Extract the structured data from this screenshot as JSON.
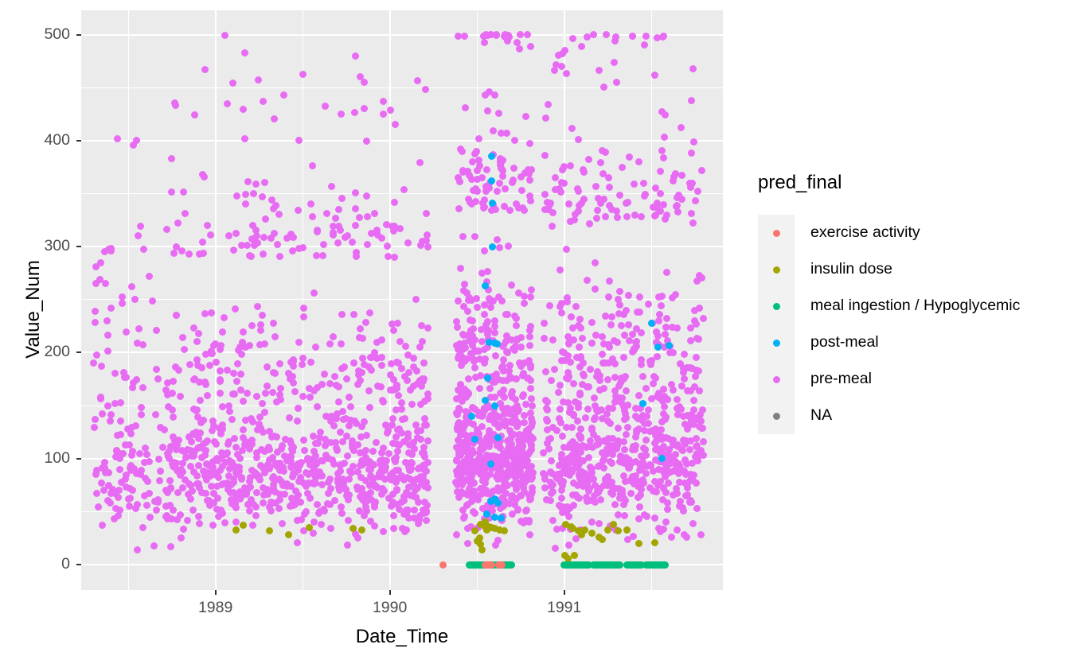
{
  "chart_data": {
    "type": "scatter",
    "title": "",
    "xlabel": "Date_Time",
    "ylabel": "Value_Num",
    "x_tick_labels": [
      "1989",
      "1990",
      "1991"
    ],
    "x_tick_values": [
      1989,
      1990,
      1991
    ],
    "y_tick_labels": [
      "0",
      "100",
      "200",
      "300",
      "400",
      "500"
    ],
    "y_tick_values": [
      0,
      100,
      200,
      300,
      400,
      500
    ],
    "xlim": [
      1988.23,
      1991.91
    ],
    "ylim": [
      -24,
      523
    ],
    "grid": true,
    "panel_background": "#EBEBEB",
    "grid_color": "#FFFFFF",
    "legend_position": "right",
    "legend_title": "pred_final",
    "series": [
      {
        "name": "exercise activity",
        "color": "#F8766D",
        "n_points": 9,
        "x_range": [
          1990.3,
          1990.72
        ],
        "y_values": [
          0,
          0,
          0,
          0,
          0,
          0,
          0,
          0,
          0
        ]
      },
      {
        "name": "insulin dose",
        "color": "#A3A500",
        "n_points": 38,
        "x_range": [
          1989.1,
          1991.62
        ],
        "y_range": [
          0,
          40
        ]
      },
      {
        "name": "meal ingestion / Hypoglycemic",
        "color": "#00BF7D",
        "n_points": 74,
        "x_range": [
          1990.45,
          1991.58
        ],
        "y_values_constant": 0
      },
      {
        "name": "post-meal",
        "color": "#00B0F6",
        "n_points": 26,
        "x_range": [
          1990.42,
          1991.62
        ],
        "y_range": [
          40,
          385
        ]
      },
      {
        "name": "pre-meal",
        "color": "#E76BF3",
        "n_points": 2600,
        "x_range": [
          1988.3,
          1991.8
        ],
        "y_range": [
          10,
          500
        ]
      },
      {
        "name": "NA",
        "color": "#808080",
        "n_points": 0,
        "x_range": [],
        "y_range": []
      }
    ]
  },
  "axes": {
    "y_title": "Value_Num",
    "x_title": "Date_Time",
    "y_ticks": [
      {
        "label": "500",
        "value": 500
      },
      {
        "label": "400",
        "value": 400
      },
      {
        "label": "300",
        "value": 300
      },
      {
        "label": "200",
        "value": 200
      },
      {
        "label": "100",
        "value": 100
      },
      {
        "label": "0",
        "value": 0
      }
    ],
    "x_ticks": [
      {
        "label": "1989",
        "value": 1989
      },
      {
        "label": "1990",
        "value": 1990
      },
      {
        "label": "1991",
        "value": 1991
      }
    ]
  },
  "legend": {
    "title": "pred_final",
    "items": [
      {
        "label": "exercise activity",
        "color": "#F8766D",
        "key_name": "legend-key-exercise-activity"
      },
      {
        "label": "insulin dose",
        "color": "#A3A500",
        "key_name": "legend-key-insulin-dose"
      },
      {
        "label": "meal ingestion / Hypoglycemic",
        "color": "#00BF7D",
        "key_name": "legend-key-meal-ingestion"
      },
      {
        "label": "post-meal",
        "color": "#00B0F6",
        "key_name": "legend-key-post-meal"
      },
      {
        "label": "pre-meal",
        "color": "#E76BF3",
        "key_name": "legend-key-pre-meal"
      },
      {
        "label": "NA",
        "color": "#808080",
        "key_name": "legend-key-na"
      }
    ]
  }
}
